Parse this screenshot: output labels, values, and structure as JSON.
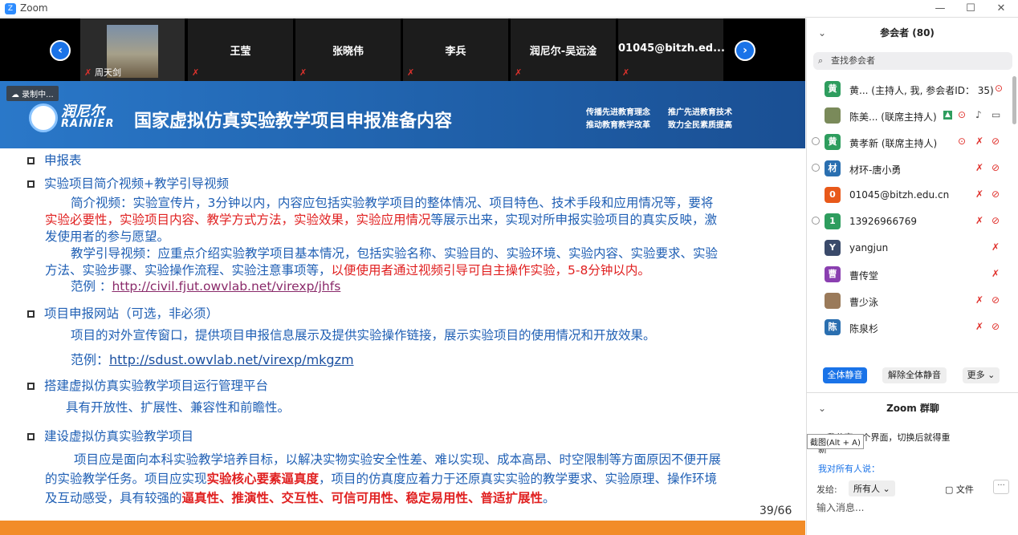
{
  "window": {
    "app_name": "Zoom",
    "logo_glyph": "Z"
  },
  "strip": {
    "tiles": [
      {
        "name": "",
        "caption": "周天剑",
        "mute": "✗"
      },
      {
        "name": "王莹",
        "mute": "✗"
      },
      {
        "name": "张晓伟",
        "mute": "✗"
      },
      {
        "name": "李兵",
        "mute": "✗"
      },
      {
        "name": "润尼尔-吴远淦",
        "mute": "✗"
      },
      {
        "name": "01045@bitzh.ed...",
        "mute": "✗"
      }
    ],
    "prev_icon": "‹",
    "next_icon": "›"
  },
  "recording": "☁ 录制中...",
  "slide": {
    "brand_cn": "润尼尔",
    "brand_en": "RAINIER",
    "title": "国家虚拟仿真实验教学项目申报准备内容",
    "slogans": [
      "传播先进教育理念",
      "推广先进教育技术",
      "推动教育教学改革",
      "致力全民素质提高"
    ],
    "h1": "申报表",
    "h2": "实验项目简介视频+教学引导视频",
    "p1a": "简介视频：实验宣传片，3分钟以内，内容应包括实验教学项目的整体情况、项目特色、技术手段和应用情况等，要将",
    "p1b_red": "实验必要性，实验项目内容、教学方式方法，实验效果，实验应用情况",
    "p1b_blue": "等展示出来，实现对所申报实验项目的真实反映，激",
    "p1c": "发使用者的参与愿望。",
    "p2a": "教学引导视频：应重点介绍实验教学项目基本情况，包括实验名称、实验目的、实验环境、实验内容、实验要求、实验",
    "p2b_blue": "方法、实验步骤、实验操作流程、实验注意事项等，",
    "p2b_red": "以便使用者通过视频引导可自主操作实验，5-8分钟以内。",
    "ex1_label": "范例 ：",
    "ex1_link": "http://civil.fjut.owvlab.net/virexp/jhfs",
    "h3": "项目申报网站（可选，非必须）",
    "p3": "项目的对外宣传窗口，提供项目申报信息展示及提供实验操作链接，展示实验项目的使用情况和开放效果。",
    "ex2_label": "范例：",
    "ex2_link": "http://sdust.owvlab.net/virexp/mkgzm",
    "h4": "搭建虚拟仿真实验教学项目运行管理平台",
    "p4": "具有开放性、扩展性、兼容性和前瞻性。",
    "h5": "建设虚拟仿真实验教学项目",
    "p5a": "项目应是面向本科实验教学培养目标，以解决实物实验安全性差、难以实现、成本高昂、时空限制等方面原因不便开展",
    "p5b_1": "的实验教学任务。项目应实现",
    "p5b_2": "实验核心要素逼真度",
    "p5b_3": "，项目的仿真度应着力于还原真实实验的教学要求、实验原理、操作环境",
    "p5c_1": "及互动感受，具有较强的",
    "p5c_2": "逼真性、推演性、交互性、可信可用性、稳定易用性、普适扩展性",
    "p5c_3": "。",
    "page": "39/66"
  },
  "panel": {
    "title": "参会者 (80)",
    "search_placeholder": "查找参会者",
    "participants": [
      {
        "avatar": "黄",
        "color": "#2e9d5e",
        "name": "黄... (主持人, 我, 参会者ID： 35)"
      },
      {
        "avatar": "",
        "color": "#7a8a5a",
        "name": "陈美... (联席主持人)"
      },
      {
        "avatar": "黄",
        "color": "#2e9d5e",
        "name": "黄孝新 (联席主持人)"
      },
      {
        "avatar": "材",
        "color": "#2a6fb0",
        "name": "材环-唐小勇"
      },
      {
        "avatar": "0",
        "color": "#e8591a",
        "name": "01045@bitzh.edu.cn"
      },
      {
        "avatar": "1",
        "color": "#2e9d5e",
        "name": "13926966769"
      },
      {
        "avatar": "Y",
        "color": "#3a4a6a",
        "name": "yangjun"
      },
      {
        "avatar": "曹",
        "color": "#8a3fb0",
        "name": "曹传堂"
      },
      {
        "avatar": "",
        "color": "#9a7a5a",
        "name": "曹少泳"
      },
      {
        "avatar": "陈",
        "color": "#2a6fb0",
        "name": "陈泉杉"
      }
    ],
    "mute_all": "全体静音",
    "unmute_all": "解除全体静音",
    "more": "更多 ⌄",
    "chat_title": "Zoom 群聊",
    "chat_line1": "...我分享一个界面，切换后就得重",
    "chat_line2": "新",
    "chat_line3": "我对所有人说：",
    "tooltip": "截图(Alt + A)",
    "send_to_label": "发给:",
    "send_to_value": "所有人 ⌄",
    "file_label": "文件",
    "input_placeholder": "输入消息..."
  }
}
